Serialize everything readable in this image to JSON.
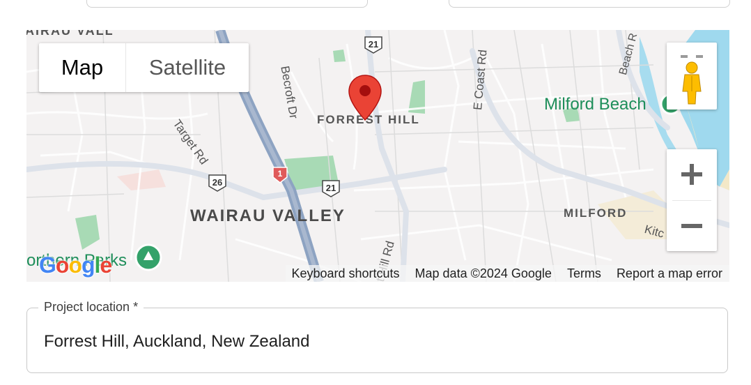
{
  "map": {
    "map_type_control": {
      "map_label": "Map",
      "satellite_label": "Satellite"
    },
    "places": {
      "wairau_valley": "WAIRAU VALLEY",
      "forrest_hill": "FORREST HILL",
      "milford": "MILFORD",
      "milford_beach": "Milford Beach",
      "northern_parks": "orthern Parks",
      "top_left": "AIRAU VALL"
    },
    "roads": {
      "becroft": "Becroft Dr",
      "target": "Target Rd",
      "e_coast": "E Coast Rd",
      "beach": "Beach R",
      "hill": "t Hill Rd",
      "kitc": "Kitc",
      "rd": "Rd"
    },
    "route_shields": {
      "sh21_top": "21",
      "sh21_mid": "21",
      "sh26": "26",
      "sh1": "1"
    },
    "google_logo": "Google",
    "attribution": {
      "keyboard_shortcuts": "Keyboard shortcuts",
      "map_data": "Map data ©2024 Google",
      "terms": "Terms",
      "report": "Report a map error"
    },
    "colors": {
      "marker": "#ea4335",
      "park": "#a8dab5",
      "water": "#9fd9ee",
      "motorway": "#8da3c2"
    }
  },
  "project_location": {
    "label": "Project location *",
    "value": "Forrest Hill, Auckland, New Zealand"
  }
}
